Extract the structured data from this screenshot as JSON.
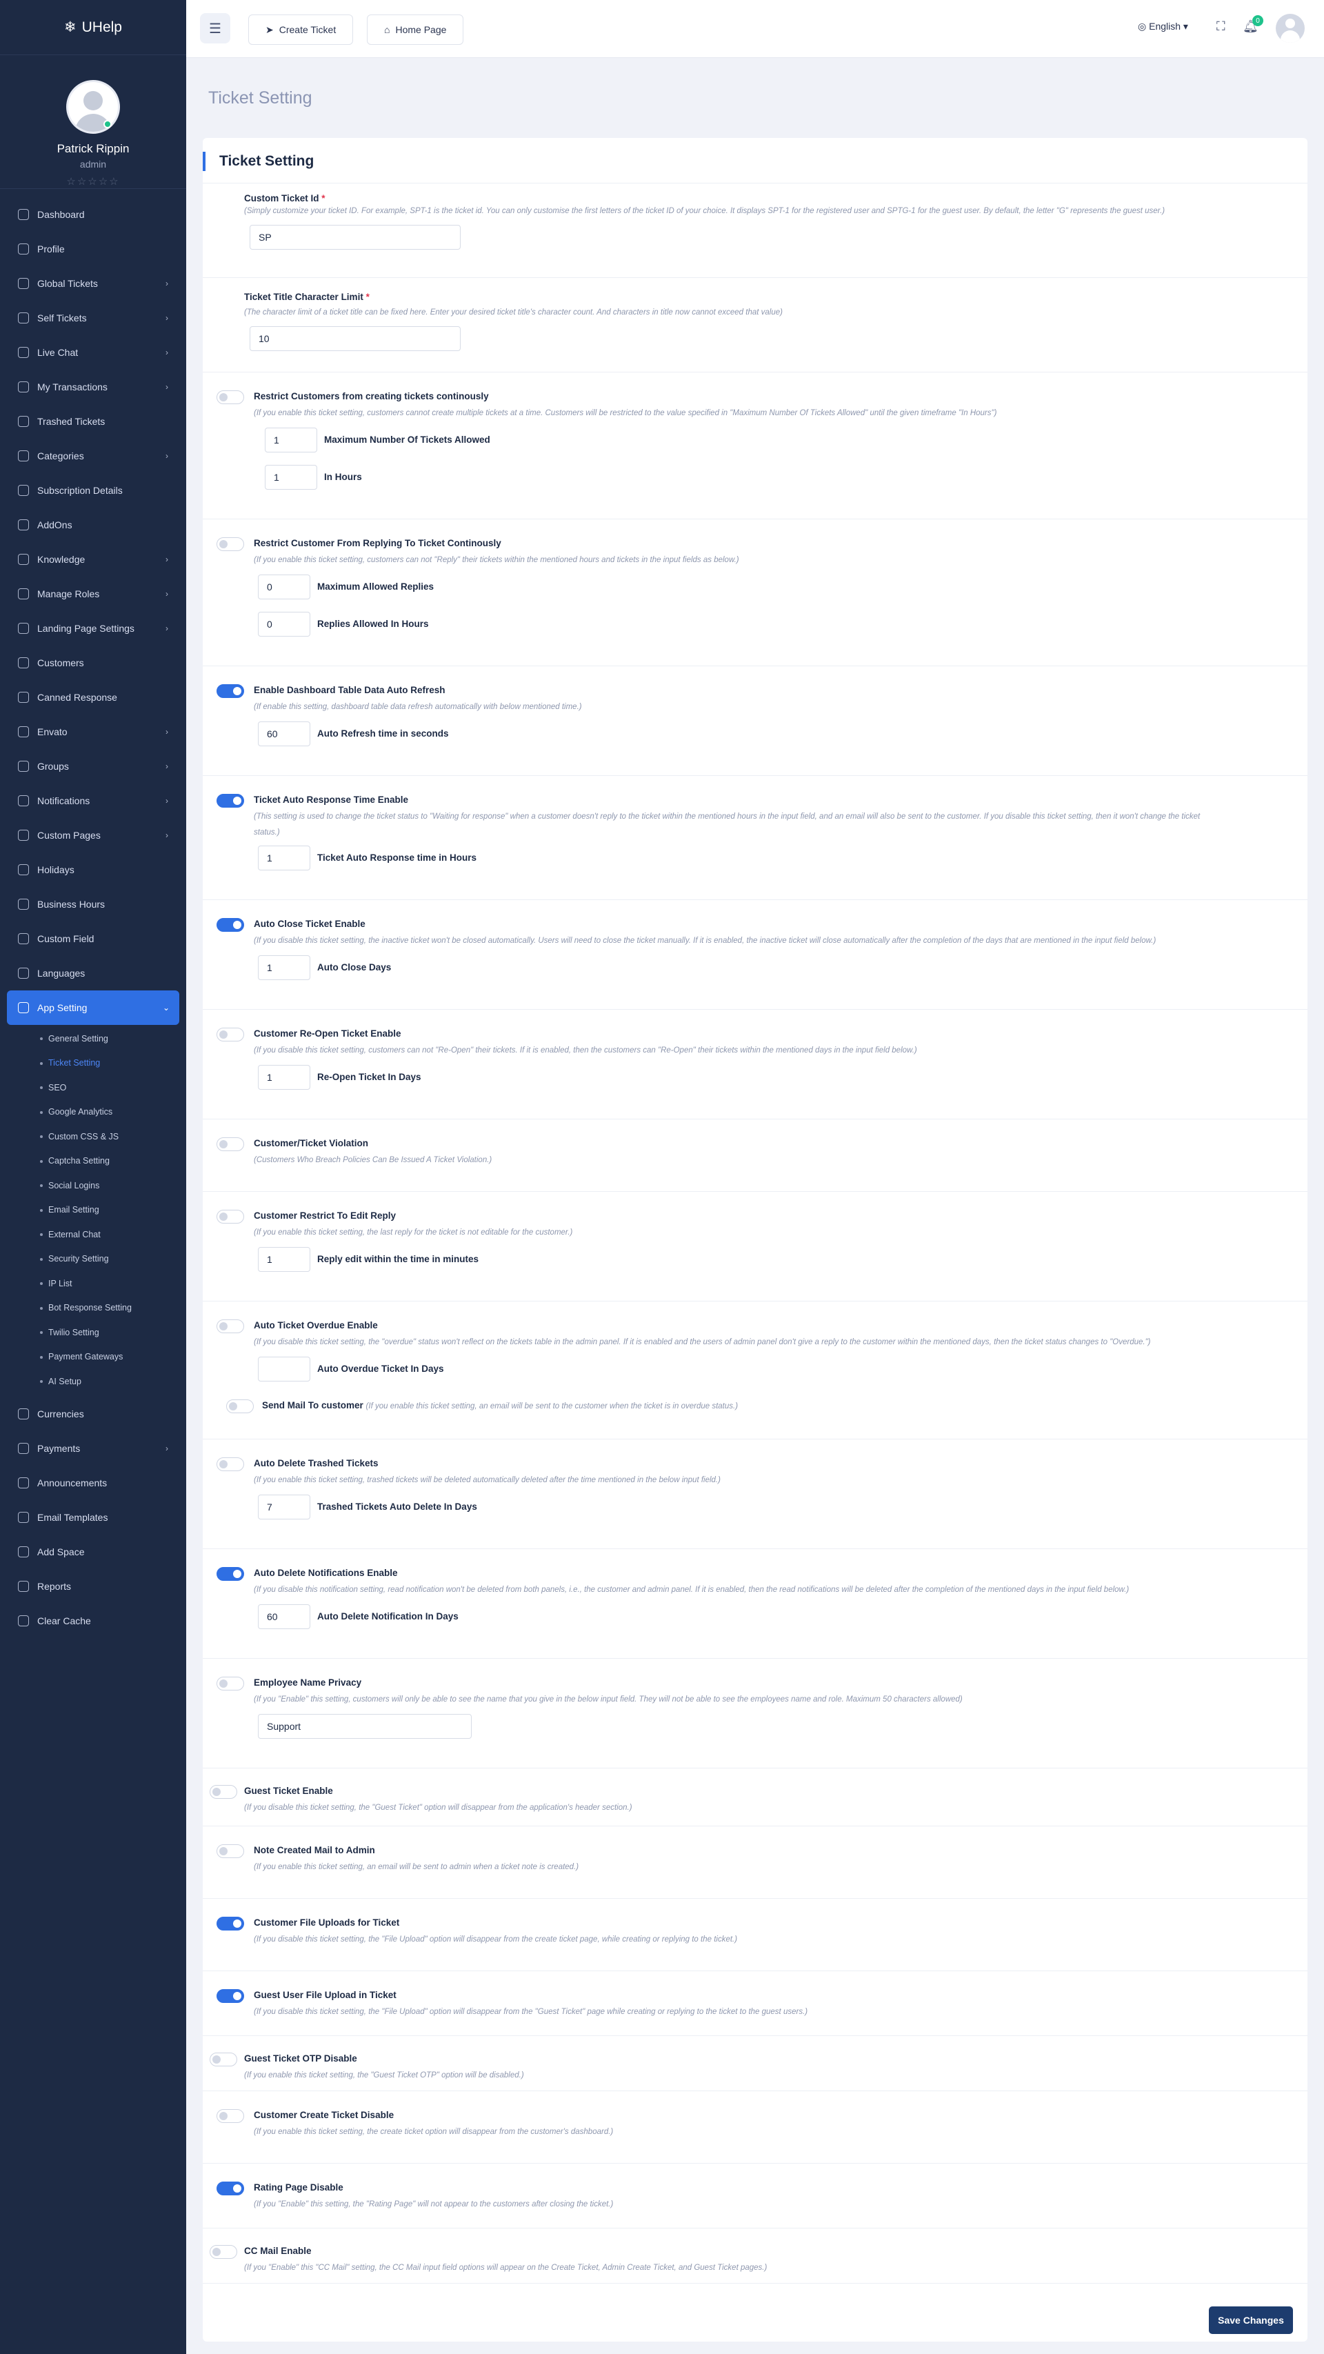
{
  "app": {
    "logo": "UHelp"
  },
  "user": {
    "name": "Patrick Rippin",
    "role": "admin",
    "stars": "☆☆☆☆☆"
  },
  "sidebar": {
    "items": [
      {
        "label": "Dashboard",
        "arrow": ""
      },
      {
        "label": "Profile",
        "arrow": ""
      },
      {
        "label": "Global Tickets",
        "arrow": "›"
      },
      {
        "label": "Self Tickets",
        "arrow": "›"
      },
      {
        "label": "Live Chat",
        "arrow": "›"
      },
      {
        "label": "My Transactions",
        "arrow": "›"
      },
      {
        "label": "Trashed Tickets",
        "arrow": ""
      },
      {
        "label": "Categories",
        "arrow": "›"
      },
      {
        "label": "Subscription Details",
        "arrow": ""
      },
      {
        "label": "AddOns",
        "arrow": ""
      },
      {
        "label": "Knowledge",
        "arrow": "›"
      },
      {
        "label": "Manage Roles",
        "arrow": "›"
      },
      {
        "label": "Landing Page Settings",
        "arrow": "›"
      },
      {
        "label": "Customers",
        "arrow": ""
      },
      {
        "label": "Canned Response",
        "arrow": ""
      },
      {
        "label": "Envato",
        "arrow": "›"
      },
      {
        "label": "Groups",
        "arrow": "›"
      },
      {
        "label": "Notifications",
        "arrow": "›"
      },
      {
        "label": "Custom Pages",
        "arrow": "›"
      },
      {
        "label": "Holidays",
        "arrow": ""
      },
      {
        "label": "Business Hours",
        "arrow": ""
      },
      {
        "label": "Custom Field",
        "arrow": ""
      },
      {
        "label": "Languages",
        "arrow": ""
      },
      {
        "label": "App Setting",
        "arrow": "⌄"
      }
    ],
    "subitems": [
      "General Setting",
      "Ticket Setting",
      "SEO",
      "Google Analytics",
      "Custom CSS & JS",
      "Captcha Setting",
      "Social Logins",
      "Email Setting",
      "External Chat",
      "Security Setting",
      "IP List",
      "Bot Response Setting",
      "Twilio Setting",
      "Payment Gateways",
      "AI Setup"
    ],
    "bottom_items": [
      {
        "label": "Currencies",
        "arrow": ""
      },
      {
        "label": "Payments",
        "arrow": "›"
      },
      {
        "label": "Announcements",
        "arrow": ""
      },
      {
        "label": "Email Templates",
        "arrow": ""
      },
      {
        "label": "Add Space",
        "arrow": ""
      },
      {
        "label": "Reports",
        "arrow": ""
      },
      {
        "label": "Clear Cache",
        "arrow": ""
      }
    ]
  },
  "topbar": {
    "create_ticket": "Create Ticket",
    "home_page": "Home Page",
    "language": "English",
    "notif_count": "0"
  },
  "page": {
    "title": "Ticket Setting",
    "card_title": "Ticket Setting",
    "save": "Save Changes"
  },
  "settings": {
    "custom_id": {
      "label": "Custom Ticket Id",
      "req": "*",
      "desc": "(Simply customize your ticket ID. For example, SPT-1 is the ticket id. You can only customise the first letters of the ticket ID of your choice. It displays SPT-1 for the registered user and SPTG-1 for the guest user. By default, the letter \"G\" represents the guest user.)",
      "value": "SP"
    },
    "title_limit": {
      "label": "Ticket Title Character Limit",
      "req": "*",
      "desc": "(The character limit of a ticket title can be fixed here. Enter your desired ticket title's character count. And characters in title now cannot exceed that value)",
      "value": "10"
    },
    "restrict_create": {
      "label": "Restrict Customers from creating tickets continously",
      "desc": "(If you enable this ticket setting, customers cannot create multiple tickets at a time. Customers will be restricted to the value specified in \"Maximum Number Of Tickets Allowed\" until the given timeframe \"In Hours\")",
      "max_value": "1",
      "max_label": "Maximum Number Of Tickets Allowed",
      "hours_value": "1",
      "hours_label": "In Hours"
    },
    "restrict_reply": {
      "label": "Restrict Customer From Replying To Ticket Continously",
      "desc": "(If you enable this ticket setting, customers can not \"Reply\" their tickets within the mentioned hours and tickets in the input fields as below.)",
      "max_value": "0",
      "max_label": "Maximum Allowed Replies",
      "hours_value": "0",
      "hours_label": "Replies Allowed In Hours"
    },
    "auto_refresh": {
      "label": "Enable Dashboard Table Data Auto Refresh",
      "desc": "(If enable this setting, dashboard table data refresh automatically with below mentioned time.)",
      "value": "60",
      "input_label": "Auto Refresh time in seconds"
    },
    "auto_response": {
      "label": "Ticket Auto Response Time Enable",
      "desc1": "(This setting is used to change the ticket status to \"Waiting for response\" when a customer doesn't reply to the ticket within the mentioned hours in the input field, and an email will also be sent to the customer. If you disable this ticket setting, then it won't change the ticket",
      "desc2": "status.)",
      "value": "1",
      "input_label": "Ticket Auto Response time in Hours"
    },
    "auto_close": {
      "label": "Auto Close Ticket Enable",
      "desc": "(If you disable this ticket setting, the inactive ticket won't be closed automatically. Users will need to close the ticket manually. If it is enabled, the inactive ticket will close automatically after the completion of the days that are mentioned in the input field below.)",
      "value": "1",
      "input_label": "Auto Close Days"
    },
    "reopen": {
      "label": "Customer Re-Open Ticket Enable",
      "desc": "(If you disable this ticket setting, customers can not \"Re-Open\" their tickets. If it is enabled, then the customers can \"Re-Open\" their tickets within the mentioned days in the input field below.)",
      "value": "1",
      "input_label": "Re-Open Ticket In Days"
    },
    "violation": {
      "label": "Customer/Ticket Violation",
      "desc": "(Customers Who Breach Policies Can Be Issued A Ticket Violation.)"
    },
    "restrict_edit": {
      "label": "Customer Restrict To Edit Reply",
      "desc": "(If you enable this ticket setting, the last reply for the ticket is not editable for the customer.)",
      "value": "1",
      "input_label": "Reply edit within the time in minutes"
    },
    "overdue": {
      "label": "Auto Ticket Overdue Enable",
      "desc": "(If you disable this ticket setting, the \"overdue\" status won't reflect on the tickets table in the admin panel. If it is enabled and the users of admin panel don't give a reply to the customer within the mentioned days, then the ticket status changes to \"Overdue.\")",
      "value": "",
      "input_label": "Auto Overdue Ticket In Days",
      "mail_label": "Send Mail To customer",
      "mail_desc": "(If you enable this ticket setting, an email will be sent to the customer when the ticket is in overdue status.)"
    },
    "auto_delete_trash": {
      "label": "Auto Delete Trashed Tickets",
      "desc": "(If you enable this ticket setting, trashed tickets will be deleted automatically deleted after the time mentioned in the below input field.)",
      "value": "7",
      "input_label": "Trashed Tickets Auto Delete In Days"
    },
    "auto_delete_notif": {
      "label": "Auto Delete Notifications Enable",
      "desc": "(If you disable this notification setting, read notification won't be deleted from both panels, i.e., the customer and admin panel. If it is enabled, then the read notifications will be deleted after the completion of the mentioned days in the input field below.)",
      "value": "60",
      "input_label": "Auto Delete Notification In Days"
    },
    "emp_privacy": {
      "label": "Employee Name Privacy",
      "desc": "(If you \"Enable\" this setting, customers will only be able to see the name that you give in the below input field. They will not be able to see the employees name and role. Maximum 50 characters allowed)",
      "value": "Support"
    },
    "guest_ticket": {
      "label": "Guest Ticket Enable",
      "desc": "(If you disable this ticket setting, the \"Guest Ticket\" option will disappear from the application's header section.)"
    },
    "note_mail": {
      "label": "Note Created Mail to Admin",
      "desc": "(If you enable this ticket setting, an email will be sent to admin when a ticket note is created.)"
    },
    "file_uploads": {
      "label": "Customer File Uploads for Ticket",
      "desc": "(If you disable this ticket setting, the \"File Upload\" option will disappear from the create ticket page, while creating or replying to the ticket.)"
    },
    "guest_upload": {
      "label": "Guest User File Upload in Ticket",
      "desc": "(If you disable this ticket setting, the \"File Upload\" option will disappear from the \"Guest Ticket\" page while creating or replying to the ticket to the guest users.)"
    },
    "guest_otp": {
      "label": "Guest Ticket OTP Disable",
      "desc": "(If you enable this ticket setting, the \"Guest Ticket OTP\" option will be disabled.)"
    },
    "create_disable": {
      "label": "Customer Create Ticket Disable",
      "desc": "(If you enable this ticket setting, the create ticket option will disappear from the customer's dashboard.)"
    },
    "rating": {
      "label": "Rating Page Disable",
      "desc": "(If you \"Enable\" this setting, the \"Rating Page\" will not appear to the customers after closing the ticket.)"
    },
    "cc_mail": {
      "label": "CC Mail Enable",
      "desc": "(If you \"Enable\" this \"CC Mail\" setting, the CC Mail input field options will appear on the Create Ticket, Admin Create Ticket, and Guest Ticket pages.)"
    }
  },
  "toggles": {
    "restrict_create": false,
    "restrict_reply": false,
    "auto_refresh": true,
    "auto_response": true,
    "auto_close": true,
    "reopen": false,
    "violation": false,
    "restrict_edit": false,
    "overdue": false,
    "overdue_mail": false,
    "auto_delete_trash": false,
    "auto_delete_notif": true,
    "emp_privacy": false,
    "guest_ticket": false,
    "note_mail": false,
    "file_uploads": true,
    "guest_upload": true,
    "guest_otp": false,
    "create_disable": false,
    "rating": true,
    "cc_mail": false
  },
  "colors": {
    "sidebar": "#1d2a44",
    "accent": "#2f6fe3",
    "save": "#1d3c6e",
    "badge": "#1ec28b"
  }
}
